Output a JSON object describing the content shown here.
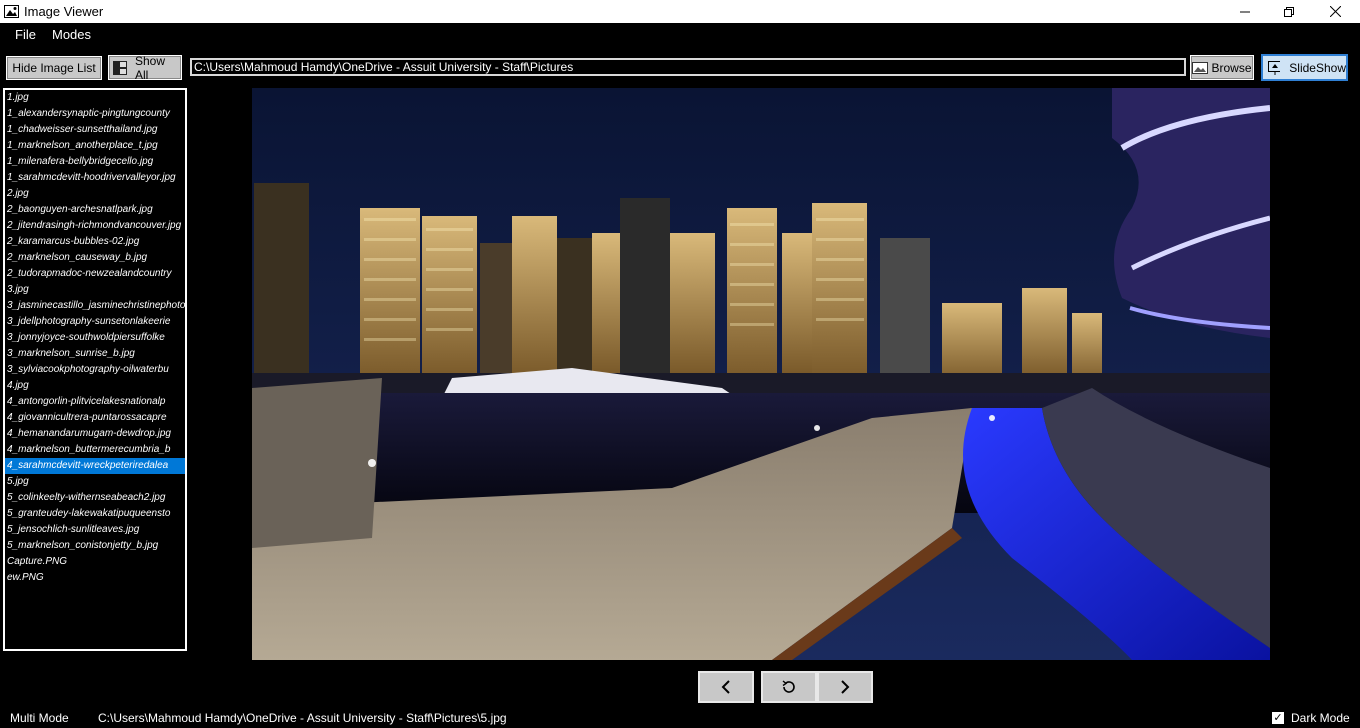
{
  "window": {
    "title": "Image Viewer"
  },
  "menu": {
    "file": "File",
    "modes": "Modes"
  },
  "toolbar": {
    "hide_list_label": "Hide Image List",
    "show_all_label": "Show All",
    "path_value": "C:\\Users\\Mahmoud Hamdy\\OneDrive - Assuit University - Staff\\Pictures",
    "browse_label": "Browse",
    "slideshow_label": "SlideShow"
  },
  "image_list": {
    "selected_index": 23,
    "items": [
      "1.jpg",
      "1_alexandersynaptic-pingtungcounty",
      "1_chadweisser-sunsetthailand.jpg",
      "1_marknelson_anotherplace_t.jpg",
      "1_milenafera-bellybridgecello.jpg",
      "1_sarahmcdevitt-hoodrivervalleyor.jpg",
      "2.jpg",
      "2_baonguyen-archesnatlpark.jpg",
      "2_jitendrasingh-richmondvancouver.jpg",
      "2_karamarcus-bubbles-02.jpg",
      "2_marknelson_causeway_b.jpg",
      "2_tudorapmadoc-newzealandcountry",
      "3.jpg",
      "3_jasminecastillo_jasminechristinephoto",
      "3_jdellphotography-sunsetonlakeerie",
      "3_jonnyjoyce-southwoldpiersuffolke",
      "3_marknelson_sunrise_b.jpg",
      "3_sylviacookphotography-oilwaterbu",
      "4.jpg",
      "4_antongorlin-plitvicelakesnationalp",
      "4_giovannicultrera-puntarossacapre",
      "4_hemanandarumugam-dewdrop.jpg",
      "4_marknelson_buttermerecumbria_b",
      "4_sarahmcdevitt-wreckpeteriredalea",
      "5.jpg",
      "5_colinkeelty-withernseabeach2.jpg",
      "5_granteudey-lakewakatipuqueensto",
      "5_jensochlich-sunlitleaves.jpg",
      "5_marknelson_conistonjetty_b.jpg",
      "Capture.PNG",
      "ew.PNG"
    ]
  },
  "navigation": {
    "prev": "‹",
    "rotate": "↻",
    "next": "›"
  },
  "status": {
    "mode": "Multi Mode",
    "current_path": "C:\\Users\\Mahmoud Hamdy\\OneDrive - Assuit University - Staff\\Pictures\\5.jpg",
    "dark_mode_label": "Dark Mode",
    "dark_mode_checked": true
  },
  "icons": {
    "minimize": "minimize-icon",
    "maximize": "restore-icon",
    "close": "close-icon",
    "show_all": "layout-icon",
    "browse": "browse-icon",
    "slideshow": "slideshow-icon"
  },
  "colors": {
    "selection": "#0078d7",
    "button": "#c8c8c8",
    "background": "#000000"
  }
}
